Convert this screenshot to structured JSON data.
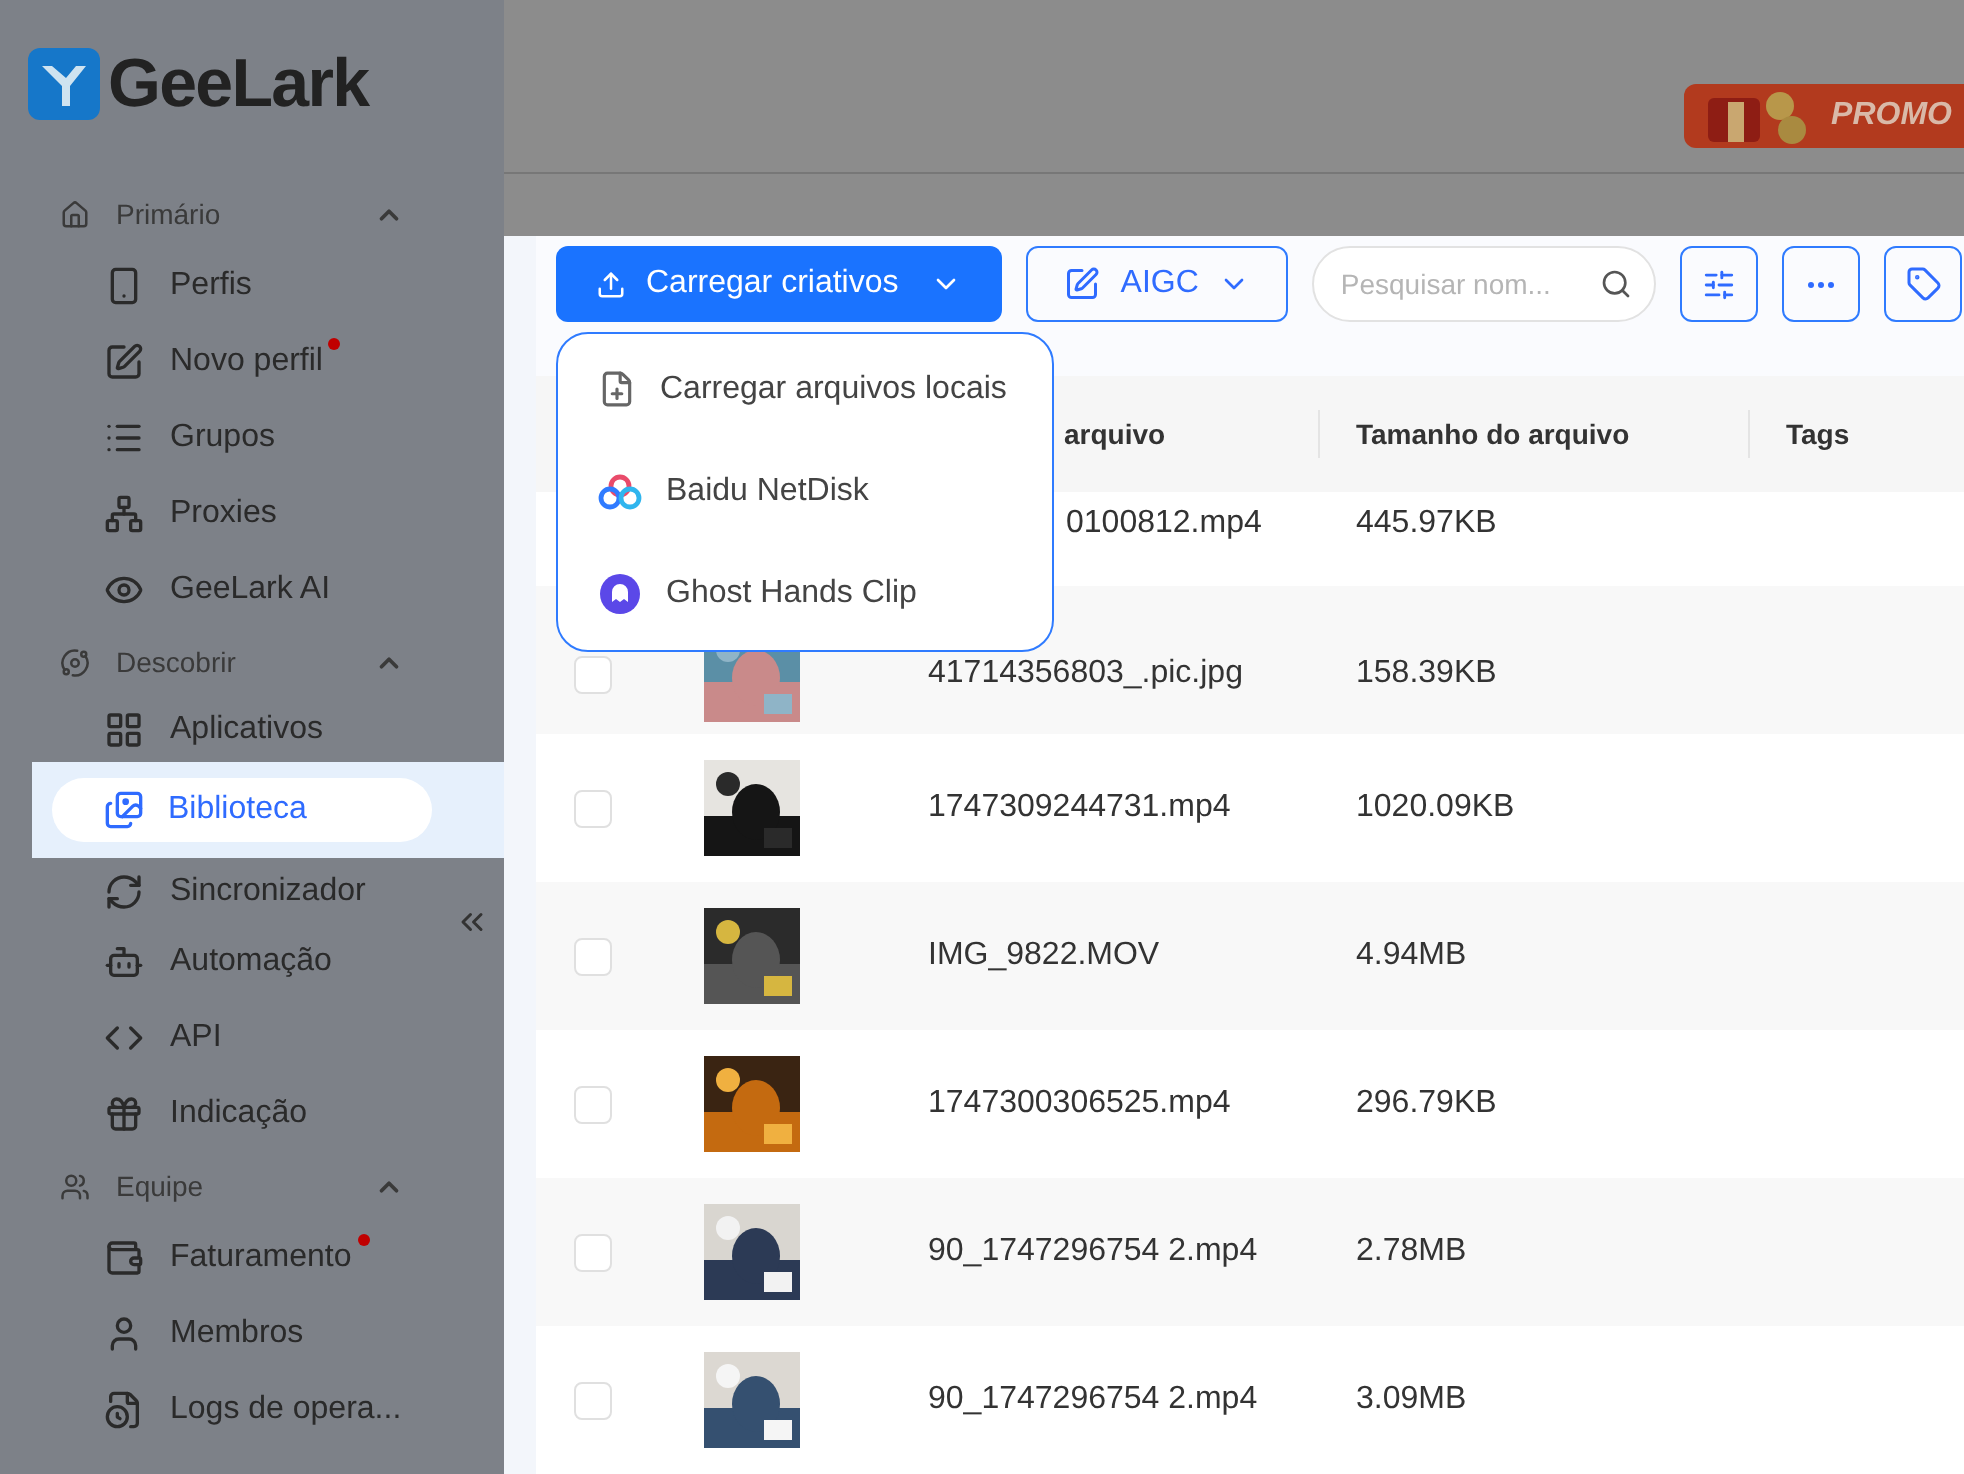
{
  "logo": {
    "text": "GeeLark"
  },
  "promo": {
    "text": "PROMO"
  },
  "sidebar": {
    "sections": [
      {
        "label": "Primário",
        "expanded": true,
        "items": [
          {
            "label": "Perfis",
            "selected": false,
            "badge": false
          },
          {
            "label": "Novo perfil",
            "selected": false,
            "badge": true
          },
          {
            "label": "Grupos",
            "selected": false,
            "badge": false
          },
          {
            "label": "Proxies",
            "selected": false,
            "badge": false
          },
          {
            "label": "GeeLark AI",
            "selected": false,
            "badge": false
          }
        ]
      },
      {
        "label": "Descobrir",
        "expanded": true,
        "items": [
          {
            "label": "Aplicativos",
            "selected": false,
            "badge": false
          },
          {
            "label": "Biblioteca",
            "selected": true,
            "badge": false
          },
          {
            "label": "Sincronizador",
            "selected": false,
            "badge": false
          },
          {
            "label": "Automação",
            "selected": false,
            "badge": false
          },
          {
            "label": "API",
            "selected": false,
            "badge": false
          },
          {
            "label": "Indicação",
            "selected": false,
            "badge": false
          }
        ]
      },
      {
        "label": "Equipe",
        "expanded": true,
        "items": [
          {
            "label": "Faturamento",
            "selected": false,
            "badge": true
          },
          {
            "label": "Membros",
            "selected": false,
            "badge": false
          },
          {
            "label": "Logs de opera...",
            "selected": false,
            "badge": false
          }
        ]
      }
    ]
  },
  "toolbar": {
    "upload_button": "Carregar criativos",
    "aigc_button": "AIGC",
    "search": {
      "placeholder": "Pesquisar nom..."
    }
  },
  "dropdown": {
    "items": [
      "Carregar arquivos locais",
      "Baidu NetDisk",
      "Ghost Hands Clip"
    ]
  },
  "table": {
    "columns": [
      "arquivo",
      "Tamanho do arquivo",
      "Tags"
    ],
    "partial_row": {
      "name": "0100812.mp4",
      "size": "445.97KB"
    },
    "rows": [
      {
        "name": "41714356803_.pic.jpg",
        "size": "158.39KB",
        "checked": false
      },
      {
        "name": "1747309244731.mp4",
        "size": "1020.09KB",
        "checked": false
      },
      {
        "name": "IMG_9822.MOV",
        "size": "4.94MB",
        "checked": false
      },
      {
        "name": "1747300306525.mp4",
        "size": "296.79KB",
        "checked": false
      },
      {
        "name": "90_1747296754 2.mp4",
        "size": "2.78MB",
        "checked": false
      },
      {
        "name": "90_1747296754 2.mp4",
        "size": "3.09MB",
        "checked": false
      }
    ]
  }
}
